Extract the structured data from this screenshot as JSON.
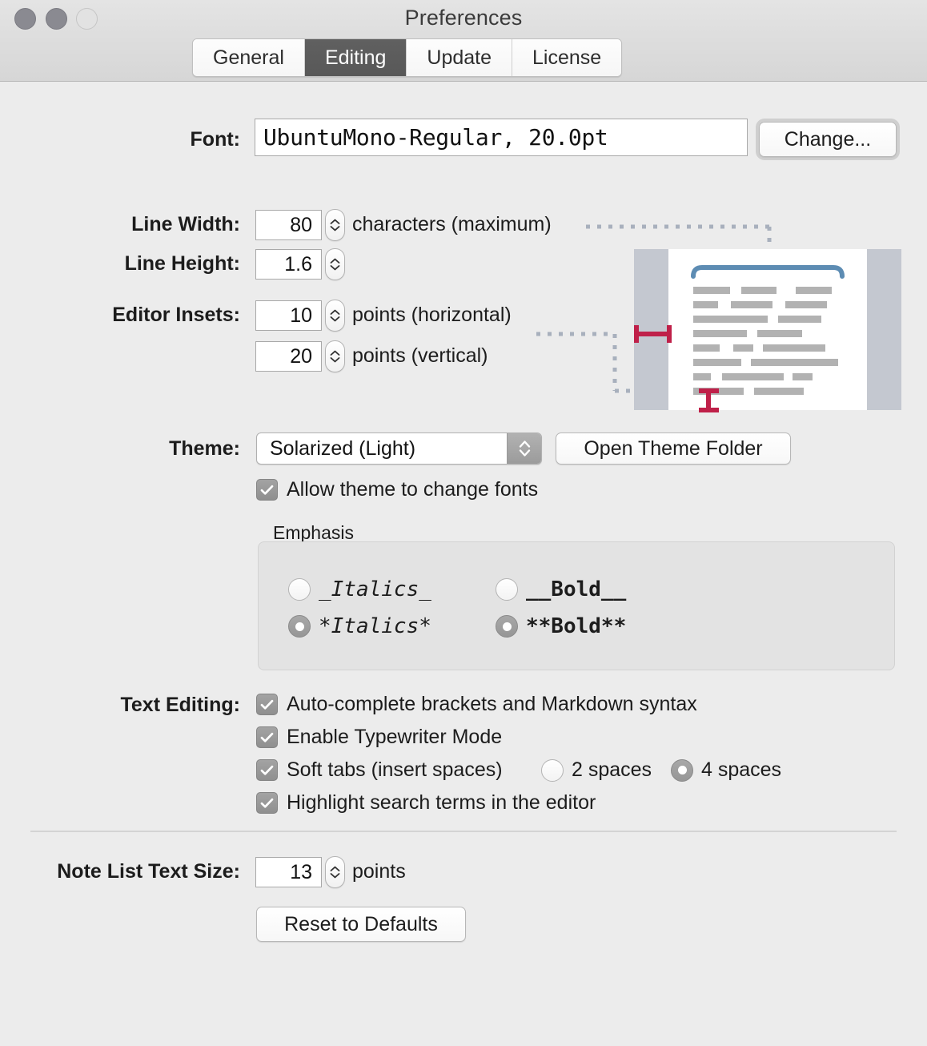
{
  "window": {
    "title": "Preferences",
    "traffic_lights": [
      "close",
      "minimize",
      "zoom"
    ]
  },
  "tabs": [
    {
      "label": "General",
      "selected": false
    },
    {
      "label": "Editing",
      "selected": true
    },
    {
      "label": "Update",
      "selected": false
    },
    {
      "label": "License",
      "selected": false
    }
  ],
  "font_row": {
    "label": "Font:",
    "value": "UbuntuMono-Regular, 20.0pt",
    "change_button": "Change..."
  },
  "metrics": {
    "line_width": {
      "label": "Line Width:",
      "value": "80",
      "unit": "characters (maximum)"
    },
    "line_height": {
      "label": "Line Height:",
      "value": "1.6",
      "unit": ""
    },
    "editor_insets": {
      "label": "Editor Insets:",
      "horizontal": {
        "value": "10",
        "unit": "points (horizontal)"
      },
      "vertical": {
        "value": "20",
        "unit": "points (vertical)"
      }
    }
  },
  "theme": {
    "label": "Theme:",
    "value": "Solarized (Light)",
    "open_folder_button": "Open Theme Folder",
    "allow_fonts": {
      "label": "Allow theme to change fonts",
      "checked": true
    }
  },
  "emphasis": {
    "title": "Emphasis",
    "italic_options": [
      {
        "label": "_Italics_",
        "selected": false
      },
      {
        "label": "*Italics*",
        "selected": true
      }
    ],
    "bold_options": [
      {
        "label": "__Bold__",
        "selected": false
      },
      {
        "label": "**Bold**",
        "selected": true
      }
    ]
  },
  "text_editing": {
    "label": "Text Editing:",
    "options": [
      {
        "label": "Auto-complete brackets and Markdown syntax",
        "checked": true
      },
      {
        "label": "Enable Typewriter Mode",
        "checked": true
      },
      {
        "label": "Soft tabs (insert spaces)",
        "checked": true
      },
      {
        "label": "Highlight search terms in the editor",
        "checked": true
      }
    ],
    "tab_width": [
      {
        "label": "2 spaces",
        "selected": false
      },
      {
        "label": "4 spaces",
        "selected": true
      }
    ]
  },
  "note_list": {
    "label": "Note List Text Size:",
    "value": "13",
    "unit": "points",
    "reset_button": "Reset to Defaults"
  },
  "preview": {
    "page_color": "#ffffff",
    "margin_color": "#c4c8d0",
    "text_bar_color": "#b2b2b2",
    "line_width_marker_color": "#5d8cb3",
    "inset_marker_color": "#bf2049",
    "connector_color": "#a8b0bd",
    "rows": [
      [
        [
          0,
          46
        ],
        [
          60,
          44
        ],
        [
          128,
          45
        ]
      ],
      [
        [
          0,
          31
        ],
        [
          47,
          52
        ],
        [
          115,
          52
        ]
      ],
      [
        [
          0,
          93
        ],
        [
          106,
          54
        ]
      ],
      [
        [
          0,
          67
        ],
        [
          80,
          56
        ]
      ],
      [
        [
          0,
          33
        ],
        [
          50,
          25
        ],
        [
          87,
          78
        ]
      ],
      [
        [
          0,
          60
        ],
        [
          72,
          109
        ]
      ],
      [
        [
          0,
          22
        ],
        [
          36,
          77
        ],
        [
          124,
          25
        ]
      ],
      [
        [
          0,
          63
        ],
        [
          76,
          62
        ]
      ]
    ]
  },
  "colors": {
    "window_bg": "#ececec",
    "titlebar_top": "#e4e4e4",
    "titlebar_bottom": "#d6d6d6",
    "selected_tab_bg": "#5c5c5c",
    "text": "#1c1c1c"
  }
}
